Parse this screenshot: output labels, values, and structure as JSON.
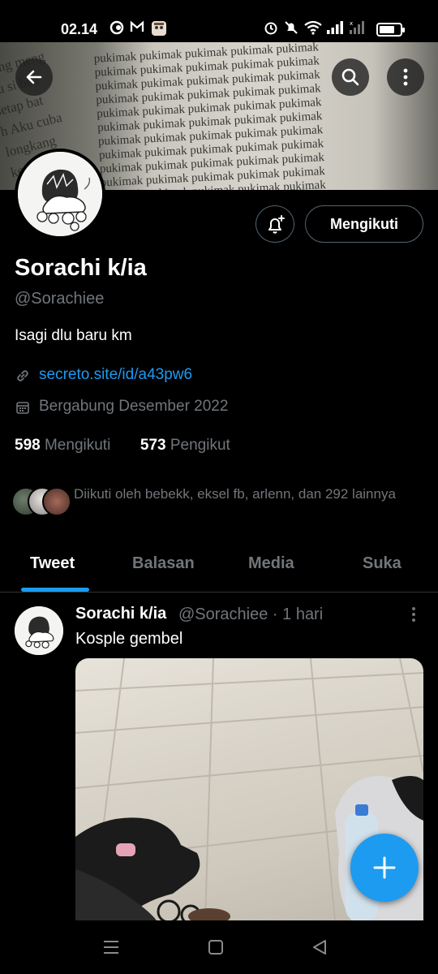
{
  "status_bar": {
    "time": "02.14",
    "icons": [
      "ring-icon",
      "gmail-icon",
      "app-icon",
      "alarm-icon",
      "mute-icon",
      "wifi-icon",
      "signal-icon",
      "signal-2-icon",
      "battery-icon"
    ]
  },
  "banner": {
    "repeated_word": "pukimak",
    "left_text": [
      "yang meng",
      "bu si bua",
      "setap bat",
      "h Aku cuba",
      "longkang",
      "kerah."
    ]
  },
  "profile": {
    "display_name": "Sorachi k/ia",
    "handle": "@Sorachiee",
    "bio": "Isagi dlu baru km",
    "link": "secreto.site/id/a43pw6",
    "joined": "Bergabung Desember 2022",
    "following_count": "598",
    "following_label": "Mengikuti",
    "followers_count": "573",
    "followers_label": "Pengikut",
    "followed_by": "Diikuti oleh bebekk, eksel fb, arlenn, dan 292 lainnya",
    "follow_button": "Mengikuti"
  },
  "tabs": [
    {
      "label": "Tweet",
      "active": true
    },
    {
      "label": "Balasan",
      "active": false
    },
    {
      "label": "Media",
      "active": false
    },
    {
      "label": "Suka",
      "active": false
    }
  ],
  "tweet": {
    "name": "Sorachi k/ia",
    "meta": "@Sorachiee · 1 hari",
    "text": "Kosple gembel"
  },
  "colors": {
    "accent": "#1d9bf0",
    "secondary_text": "#71767b",
    "background": "#000000"
  }
}
